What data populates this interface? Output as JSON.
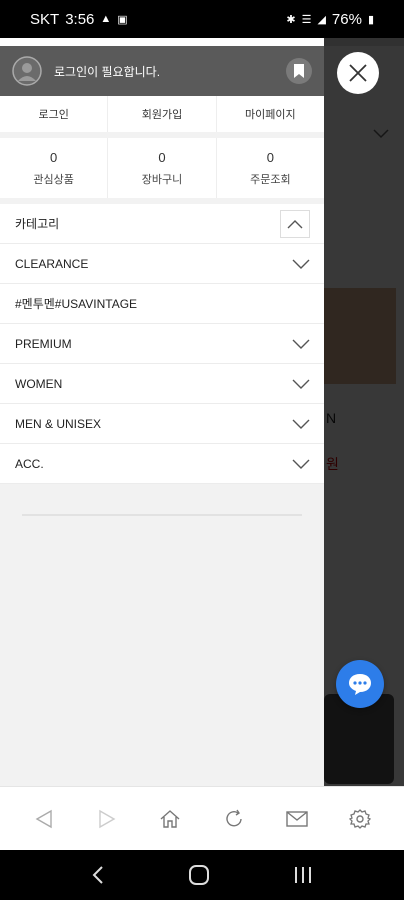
{
  "status_bar": {
    "carrier": "SKT",
    "time": "3:56",
    "battery": "76%"
  },
  "drawer": {
    "login_notice": "로그인이 필요합니다.",
    "auth_links": [
      "로그인",
      "회원가입",
      "마이페이지"
    ],
    "counters": [
      {
        "value": "0",
        "label": "관심상품"
      },
      {
        "value": "0",
        "label": "장바구니"
      },
      {
        "value": "0",
        "label": "주문조회"
      }
    ],
    "menu": [
      {
        "label": "카테고리",
        "chevron": "up"
      },
      {
        "label": "CLEARANCE",
        "chevron": "down"
      },
      {
        "label": "#멘투멘#USAVINTAGE",
        "chevron": "none"
      },
      {
        "label": "PREMIUM",
        "chevron": "down"
      },
      {
        "label": "WOMEN",
        "chevron": "down"
      },
      {
        "label": "MEN & UNISEX",
        "chevron": "down"
      },
      {
        "label": "ACC.",
        "chevron": "down"
      }
    ]
  },
  "background_page": {
    "text_n": "N",
    "text_won": "원"
  },
  "colors": {
    "profile_bg": "#5a5a5a",
    "chat_fab": "#2d7de9"
  },
  "icons": {
    "toolbar": [
      "back-icon",
      "forward-icon",
      "home-icon",
      "refresh-icon",
      "mail-icon",
      "settings-icon"
    ],
    "system_nav": [
      "nav-back-icon",
      "nav-home-icon",
      "nav-recents-icon"
    ]
  }
}
